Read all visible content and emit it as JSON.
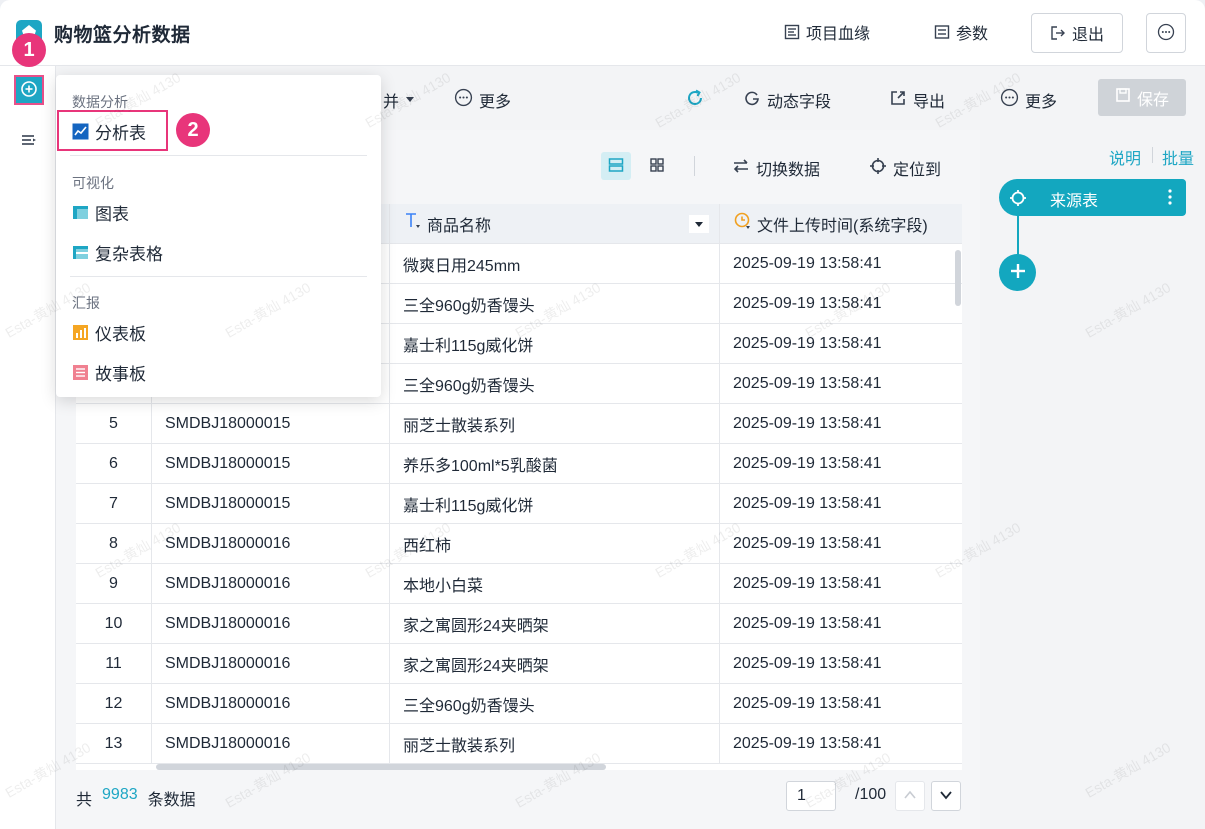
{
  "header": {
    "title": "购物篮分析数据",
    "lineage_label": "项目血缘",
    "params_label": "参数",
    "exit_label": "退出"
  },
  "badges": {
    "one": "1",
    "two": "2"
  },
  "toolbar": {
    "merge_partial": "并",
    "more_label": "更多",
    "dynamic_field_label": "动态字段",
    "export_label": "导出",
    "more_label_2": "更多",
    "save_label": "保存"
  },
  "subtoolbar": {
    "switch_data_label": "切换数据",
    "locate_label": "定位到"
  },
  "dropdown": {
    "group_analysis": "数据分析",
    "analysis_table": "分析表",
    "group_visual": "可视化",
    "chart": "图表",
    "complex_table": "复杂表格",
    "group_report": "汇报",
    "dashboard": "仪表板",
    "storyboard": "故事板"
  },
  "table": {
    "col_name": "商品名称",
    "col_time": "文件上传时间(系统字段)",
    "rows": [
      {
        "idx": "",
        "code": "",
        "name": "微爽日用245mm",
        "time": "2025-09-19 13:58:41"
      },
      {
        "idx": "",
        "code": "",
        "name": "三全960g奶香馒头",
        "time": "2025-09-19 13:58:41"
      },
      {
        "idx": "",
        "code": "",
        "name": "嘉士利115g威化饼",
        "time": "2025-09-19 13:58:41"
      },
      {
        "idx": "",
        "code": "",
        "name": "三全960g奶香馒头",
        "time": "2025-09-19 13:58:41"
      },
      {
        "idx": "5",
        "code": "SMDBJ18000015",
        "name": "丽芝士散装系列",
        "time": "2025-09-19 13:58:41"
      },
      {
        "idx": "6",
        "code": "SMDBJ18000015",
        "name": "养乐多100ml*5乳酸菌",
        "time": "2025-09-19 13:58:41"
      },
      {
        "idx": "7",
        "code": "SMDBJ18000015",
        "name": "嘉士利115g威化饼",
        "time": "2025-09-19 13:58:41"
      },
      {
        "idx": "8",
        "code": "SMDBJ18000016",
        "name": "西红柿",
        "time": "2025-09-19 13:58:41"
      },
      {
        "idx": "9",
        "code": "SMDBJ18000016",
        "name": "本地小白菜",
        "time": "2025-09-19 13:58:41"
      },
      {
        "idx": "10",
        "code": "SMDBJ18000016",
        "name": "家之寓圆形24夹晒架",
        "time": "2025-09-19 13:58:41"
      },
      {
        "idx": "11",
        "code": "SMDBJ18000016",
        "name": "家之寓圆形24夹晒架",
        "time": "2025-09-19 13:58:41"
      },
      {
        "idx": "12",
        "code": "SMDBJ18000016",
        "name": "三全960g奶香馒头",
        "time": "2025-09-19 13:58:41"
      },
      {
        "idx": "13",
        "code": "SMDBJ18000016",
        "name": "丽芝士散装系列",
        "time": "2025-09-19 13:58:41"
      }
    ]
  },
  "footer": {
    "prefix": "共",
    "count": "9983",
    "suffix": "条数据",
    "page_value": "1",
    "page_total": "/100"
  },
  "right_panel": {
    "explain_label": "说明",
    "batch_label": "批量",
    "source_node_label": "来源表"
  },
  "watermark": "Esta-黄灿 4130",
  "colors": {
    "accent": "#1ea6c4",
    "highlight": "#e8357a"
  }
}
